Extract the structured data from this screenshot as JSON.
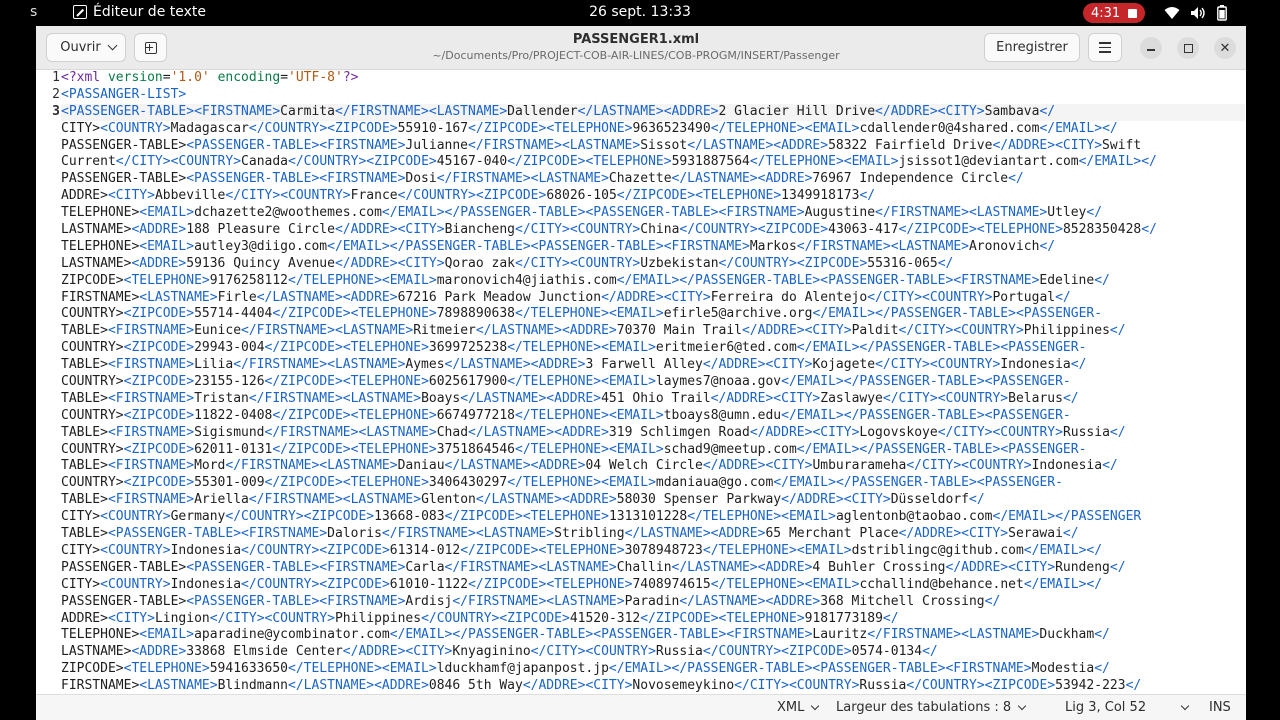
{
  "topbar": {
    "left_fragment": "s",
    "app_name": "Éditeur de texte",
    "clock": "26 sept.  13:33",
    "recording_time": "4:31",
    "icons": [
      "wifi-icon",
      "volume-icon",
      "battery-icon",
      "power-icon"
    ]
  },
  "header": {
    "open_label": "Ouvrir",
    "title": "PASSENGER1.xml",
    "path": "~/Documents/Pro/PROJECT-COB-AIR-LINES/COB-PROGM/INSERT/Passenger",
    "save_label": "Enregistrer",
    "close_symbol": "✕"
  },
  "editor": {
    "line_numbers": [
      "1",
      "2",
      "3"
    ],
    "current_line": 3,
    "lines": [
      "<?xml version='1.0' encoding='UTF-8'?>",
      "<PASSANGER-LIST>",
      "<PASSENGER-TABLE><FIRSTNAME>Carmita</FIRSTNAME><LASTNAME>Dallender</LASTNAME><ADDRE>2 Glacier Hill Drive</ADDRE><CITY>Sambava</",
      "CITY><COUNTRY>Madagascar</COUNTRY><ZIPCODE>55910-167</ZIPCODE><TELEPHONE>9636523490</TELEPHONE><EMAIL>cdallender0@4shared.com</EMAIL></",
      "PASSENGER-TABLE><PASSENGER-TABLE><FIRSTNAME>Julianne</FIRSTNAME><LASTNAME>Sissot</LASTNAME><ADDRE>58322 Fairfield Drive</ADDRE><CITY>Swift",
      "Current</CITY><COUNTRY>Canada</COUNTRY><ZIPCODE>45167-040</ZIPCODE><TELEPHONE>5931887564</TELEPHONE><EMAIL>jsissot1@deviantart.com</EMAIL></",
      "PASSENGER-TABLE><PASSENGER-TABLE><FIRSTNAME>Dosi</FIRSTNAME><LASTNAME>Chazette</LASTNAME><ADDRE>76967 Independence Circle</",
      "ADDRE><CITY>Abbeville</CITY><COUNTRY>France</COUNTRY><ZIPCODE>68026-105</ZIPCODE><TELEPHONE>1349918173</",
      "TELEPHONE><EMAIL>dchazette2@woothemes.com</EMAIL></PASSENGER-TABLE><PASSENGER-TABLE><FIRSTNAME>Augustine</FIRSTNAME><LASTNAME>Utley</",
      "LASTNAME><ADDRE>188 Pleasure Circle</ADDRE><CITY>Biancheng</CITY><COUNTRY>China</COUNTRY><ZIPCODE>43063-417</ZIPCODE><TELEPHONE>8528350428</",
      "TELEPHONE><EMAIL>autley3@diigo.com</EMAIL></PASSENGER-TABLE><PASSENGER-TABLE><FIRSTNAME>Markos</FIRSTNAME><LASTNAME>Aronovich</",
      "LASTNAME><ADDRE>59136 Quincy Avenue</ADDRE><CITY>Qorao zak</CITY><COUNTRY>Uzbekistan</COUNTRY><ZIPCODE>55316-065</",
      "ZIPCODE><TELEPHONE>9176258112</TELEPHONE><EMAIL>maronovich4@jiathis.com</EMAIL></PASSENGER-TABLE><PASSENGER-TABLE><FIRSTNAME>Edeline</",
      "FIRSTNAME><LASTNAME>Firle</LASTNAME><ADDRE>67216 Park Meadow Junction</ADDRE><CITY>Ferreira do Alentejo</CITY><COUNTRY>Portugal</",
      "COUNTRY><ZIPCODE>55714-4404</ZIPCODE><TELEPHONE>7898890638</TELEPHONE><EMAIL>efirle5@archive.org</EMAIL></PASSENGER-TABLE><PASSENGER-",
      "TABLE><FIRSTNAME>Eunice</FIRSTNAME><LASTNAME>Ritmeier</LASTNAME><ADDRE>70370 Main Trail</ADDRE><CITY>Paldit</CITY><COUNTRY>Philippines</",
      "COUNTRY><ZIPCODE>29943-004</ZIPCODE><TELEPHONE>3699725238</TELEPHONE><EMAIL>eritmeier6@ted.com</EMAIL></PASSENGER-TABLE><PASSENGER-",
      "TABLE><FIRSTNAME>Lilia</FIRSTNAME><LASTNAME>Aymes</LASTNAME><ADDRE>3 Farwell Alley</ADDRE><CITY>Kojagete</CITY><COUNTRY>Indonesia</",
      "COUNTRY><ZIPCODE>23155-126</ZIPCODE><TELEPHONE>6025617900</TELEPHONE><EMAIL>laymes7@noaa.gov</EMAIL></PASSENGER-TABLE><PASSENGER-",
      "TABLE><FIRSTNAME>Tristan</FIRSTNAME><LASTNAME>Boays</LASTNAME><ADDRE>451 Ohio Trail</ADDRE><CITY>Zaslawye</CITY><COUNTRY>Belarus</",
      "COUNTRY><ZIPCODE>11822-0408</ZIPCODE><TELEPHONE>6674977218</TELEPHONE><EMAIL>tboays8@umn.edu</EMAIL></PASSENGER-TABLE><PASSENGER-",
      "TABLE><FIRSTNAME>Sigismund</FIRSTNAME><LASTNAME>Chad</LASTNAME><ADDRE>319 Schlimgen Road</ADDRE><CITY>Logovskoye</CITY><COUNTRY>Russia</",
      "COUNTRY><ZIPCODE>62011-0131</ZIPCODE><TELEPHONE>3751864546</TELEPHONE><EMAIL>schad9@meetup.com</EMAIL></PASSENGER-TABLE><PASSENGER-",
      "TABLE><FIRSTNAME>Mord</FIRSTNAME><LASTNAME>Daniau</LASTNAME><ADDRE>04 Welch Circle</ADDRE><CITY>Umburarameha</CITY><COUNTRY>Indonesia</",
      "COUNTRY><ZIPCODE>55301-009</ZIPCODE><TELEPHONE>3406430297</TELEPHONE><EMAIL>mdaniaua@go.com</EMAIL></PASSENGER-TABLE><PASSENGER-",
      "TABLE><FIRSTNAME>Ariella</FIRSTNAME><LASTNAME>Glenton</LASTNAME><ADDRE>58030 Spenser Parkway</ADDRE><CITY>Düsseldorf</",
      "CITY><COUNTRY>Germany</COUNTRY><ZIPCODE>13668-083</ZIPCODE><TELEPHONE>1313101228</TELEPHONE><EMAIL>aglentonb@taobao.com</EMAIL></PASSENGER",
      "TABLE><PASSENGER-TABLE><FIRSTNAME>Daloris</FIRSTNAME><LASTNAME>Stribling</LASTNAME><ADDRE>65 Merchant Place</ADDRE><CITY>Serawai</",
      "CITY><COUNTRY>Indonesia</COUNTRY><ZIPCODE>61314-012</ZIPCODE><TELEPHONE>3078948723</TELEPHONE><EMAIL>dstriblingc@github.com</EMAIL></",
      "PASSENGER-TABLE><PASSENGER-TABLE><FIRSTNAME>Carla</FIRSTNAME><LASTNAME>Challin</LASTNAME><ADDRE>4 Buhler Crossing</ADDRE><CITY>Rundeng</",
      "CITY><COUNTRY>Indonesia</COUNTRY><ZIPCODE>61010-1122</ZIPCODE><TELEPHONE>7408974615</TELEPHONE><EMAIL>cchallind@behance.net</EMAIL></",
      "PASSENGER-TABLE><PASSENGER-TABLE><FIRSTNAME>Ardisj</FIRSTNAME><LASTNAME>Paradin</LASTNAME><ADDRE>368 Mitchell Crossing</",
      "ADDRE><CITY>Lingion</CITY><COUNTRY>Philippines</COUNTRY><ZIPCODE>41520-312</ZIPCODE><TELEPHONE>9181773189</",
      "TELEPHONE><EMAIL>aparadine@ycombinator.com</EMAIL></PASSENGER-TABLE><PASSENGER-TABLE><FIRSTNAME>Lauritz</FIRSTNAME><LASTNAME>Duckham</",
      "LASTNAME><ADDRE>33868 Elmside Center</ADDRE><CITY>Knyaginino</CITY><COUNTRY>Russia</COUNTRY><ZIPCODE>0574-0134</",
      "ZIPCODE><TELEPHONE>5941633650</TELEPHONE><EMAIL>lduckhamf@japanpost.jp</EMAIL></PASSENGER-TABLE><PASSENGER-TABLE><FIRSTNAME>Modestia</",
      "FIRSTNAME><LASTNAME>Blindmann</LASTNAME><ADDRE>0846 5th Way</ADDRE><CITY>Novosemeykino</CITY><COUNTRY>Russia</COUNTRY><ZIPCODE>53942-223</"
    ]
  },
  "status": {
    "language": "XML",
    "tab_width": "Largeur des tabulations : 8",
    "cursor": "Lig 3, Col 52",
    "mode": "INS"
  },
  "colors": {
    "tag": "#1a64c8",
    "attribute": "#0b7a48",
    "string": "#b05a14",
    "recording": "#c5262a"
  }
}
